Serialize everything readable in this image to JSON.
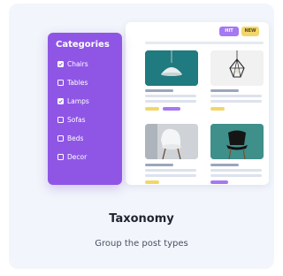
{
  "badges": {
    "hit": "HIT",
    "new": "NEW"
  },
  "categories": {
    "title": "Categories",
    "items": [
      {
        "label": "Chairs",
        "checked": true
      },
      {
        "label": "Tables",
        "checked": false
      },
      {
        "label": "Lamps",
        "checked": true
      },
      {
        "label": "Sofas",
        "checked": false
      },
      {
        "label": "Beds",
        "checked": false
      },
      {
        "label": "Decor",
        "checked": false
      }
    ]
  },
  "products": [
    {
      "image": "pendant-lamp-icon",
      "background": "#1f7b7f"
    },
    {
      "image": "cage-lamp-icon",
      "background": "#f1f1f1"
    },
    {
      "image": "white-chair-icon",
      "background": "#cfd3d8"
    },
    {
      "image": "black-chair-icon",
      "background": "#3f8f8a"
    }
  ],
  "feature": {
    "title": "Taxonomy",
    "subtitle": "Group the post types"
  },
  "colors": {
    "accent": "#8f56e6",
    "tag_yellow": "#f3d66a",
    "tag_purple": "#a678f2",
    "card_background": "#f2f5fb"
  }
}
